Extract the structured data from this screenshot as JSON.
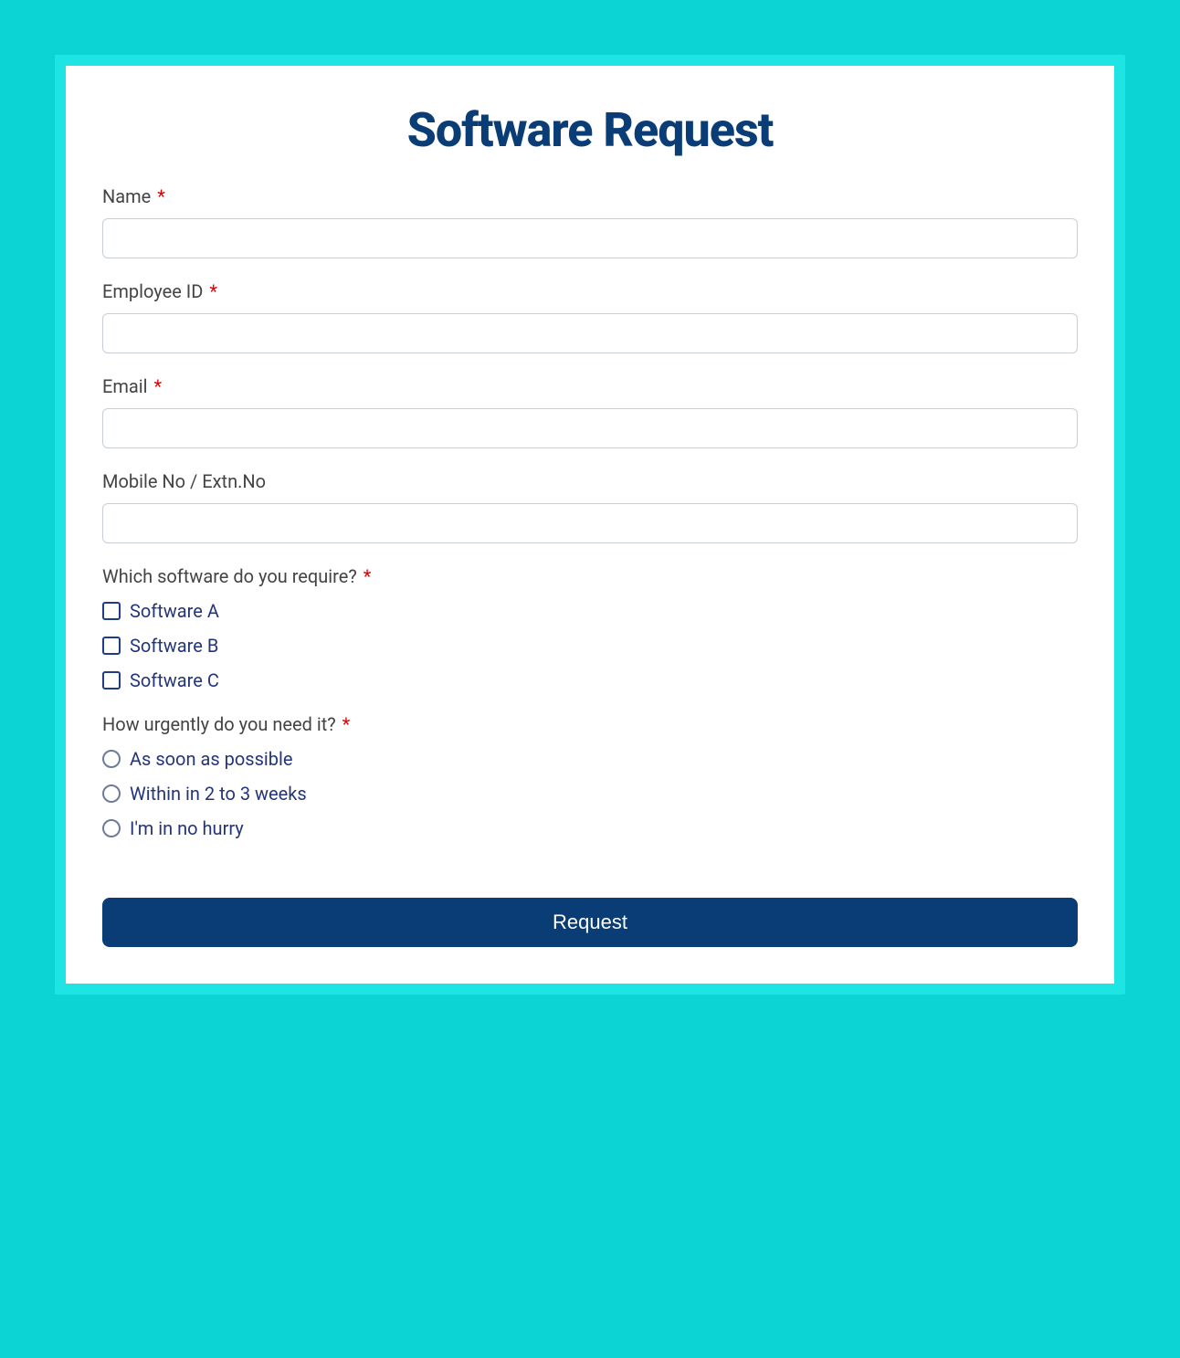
{
  "form": {
    "title": "Software Request",
    "fields": {
      "name": {
        "label": "Name",
        "required": true,
        "value": ""
      },
      "employee_id": {
        "label": "Employee ID",
        "required": true,
        "value": ""
      },
      "email": {
        "label": "Email",
        "required": true,
        "value": ""
      },
      "mobile": {
        "label": "Mobile No / Extn.No",
        "required": false,
        "value": ""
      },
      "software": {
        "label": "Which software do you require?",
        "required": true,
        "options": [
          "Software A",
          "Software B",
          "Software C"
        ]
      },
      "urgency": {
        "label": "How urgently do you need it?",
        "required": true,
        "options": [
          "As soon as possible",
          "Within in 2 to 3 weeks",
          "I'm in no hurry"
        ]
      }
    },
    "submit_label": "Request",
    "required_marker": "*"
  }
}
